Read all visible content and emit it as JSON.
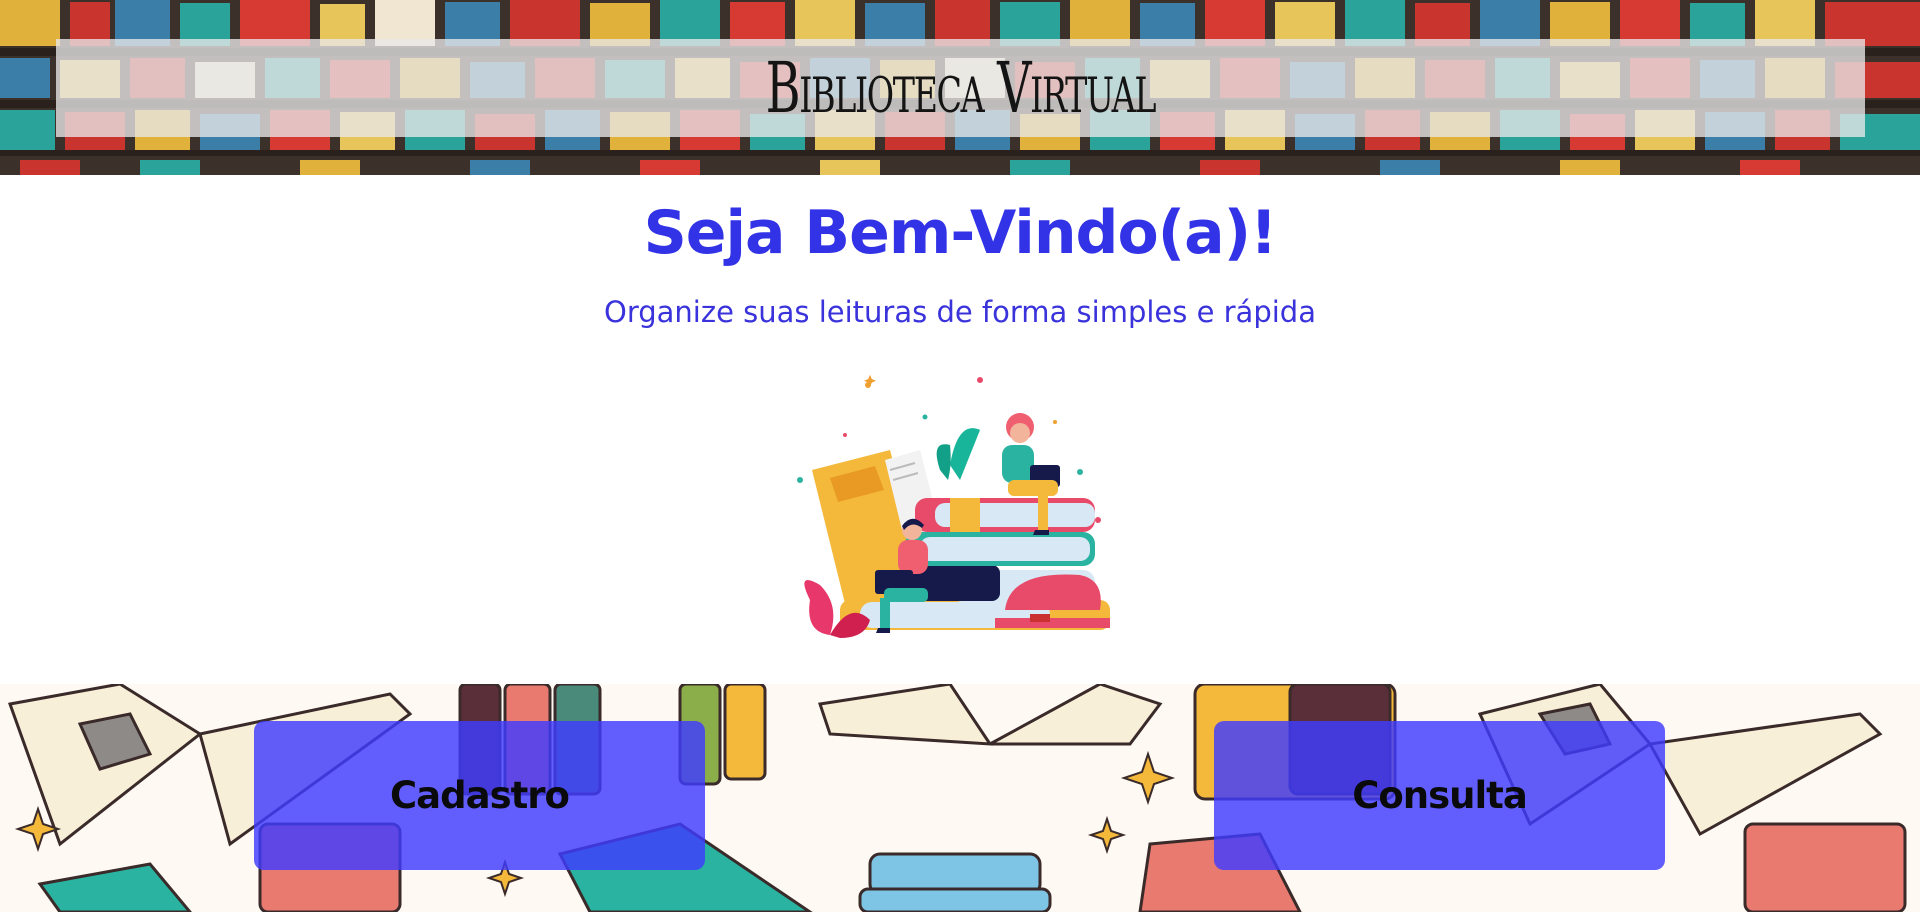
{
  "header": {
    "site_title": "Biblioteca Virtual"
  },
  "welcome": {
    "title": "Seja Bem-Vindo(a)!",
    "subtitle": "Organize suas leituras de forma simples e rápida"
  },
  "hero": {
    "illustration": "people-reading-on-book-stack"
  },
  "actions": {
    "cadastro_label": "Cadastro",
    "consulta_label": "Consulta"
  },
  "colors": {
    "accent": "#3232e6",
    "button": "#403cff",
    "title_box": "#e8e8e8"
  }
}
